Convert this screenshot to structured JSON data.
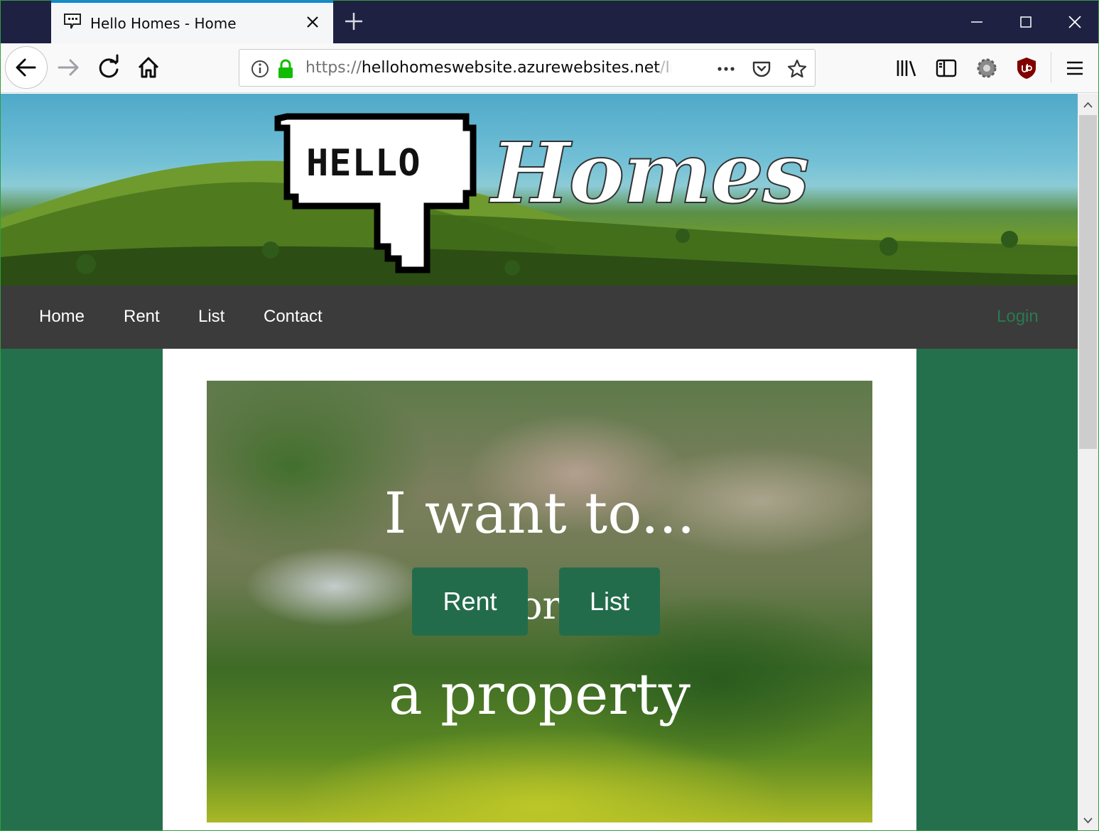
{
  "browser": {
    "tab_title": "Hello Homes - Home",
    "url_scheme": "https://",
    "url_host": "hellohomeswebsite.azurewebsites.net",
    "url_path": "/Index",
    "icons": [
      "back-icon",
      "forward-icon",
      "reload-icon",
      "home-icon",
      "info-icon",
      "lock-icon",
      "more-icon",
      "pocket-icon",
      "bookmark-star-icon",
      "library-icon",
      "sidebar-icon",
      "settings-gear-icon",
      "ublock-icon",
      "menu-icon"
    ]
  },
  "banner": {
    "logo_speech_text": "HELLO",
    "logo_script_text": "Homes"
  },
  "site_nav": {
    "items": [
      {
        "label": "Home"
      },
      {
        "label": "Rent"
      },
      {
        "label": "List"
      },
      {
        "label": "Contact"
      }
    ],
    "login_label": "Login"
  },
  "hero": {
    "line1": "I want to...",
    "rent_label": "Rent",
    "or_text": "or",
    "list_label": "List",
    "line3": "a property"
  },
  "colors": {
    "brand_green": "#236c4b",
    "page_background": "#24704c",
    "nav_background": "#3b3b3b",
    "tabbar_background": "#1f2143"
  }
}
